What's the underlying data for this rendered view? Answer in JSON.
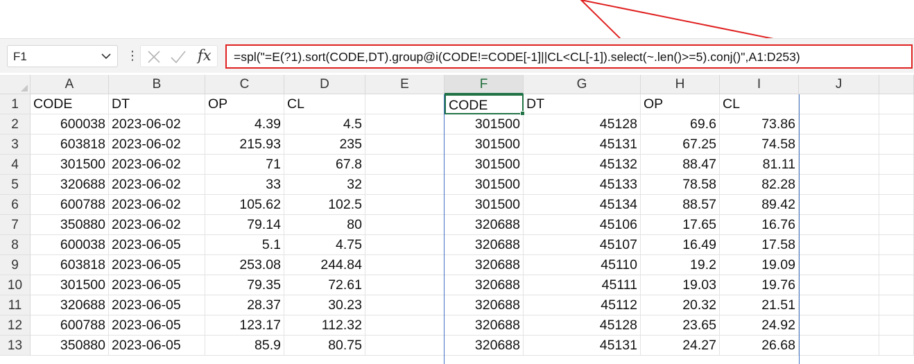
{
  "name_box": {
    "value": "F1"
  },
  "formula_bar": {
    "separator_glyph": "⋮",
    "fx_label": "fx",
    "formula": "=spl(\"=E(?1).sort(CODE,DT).group@i(CODE!=CODE[-1]||CL<CL[-1]).select(~.len()>=5).conj()\",A1:D253)"
  },
  "colors": {
    "annotation": "#e02020",
    "selection": "#217346",
    "spill_border": "#4472c4"
  },
  "icons": [
    "chevron-down-icon",
    "cancel-icon",
    "enter-check-icon",
    "function-fx-icon"
  ],
  "columns": [
    "A",
    "B",
    "C",
    "D",
    "E",
    "F",
    "G",
    "H",
    "I",
    "J"
  ],
  "rows": [
    "1",
    "2",
    "3",
    "4",
    "5",
    "6",
    "7",
    "8",
    "9",
    "10",
    "11",
    "12",
    "13"
  ],
  "active_cell": "F1",
  "cells": [
    [
      "CODE",
      "DT",
      "OP",
      "CL",
      "",
      "CODE",
      "DT",
      "OP",
      "CL",
      ""
    ],
    [
      "600038",
      "2023-06-02",
      "4.39",
      "4.5",
      "",
      "301500",
      "45128",
      "69.6",
      "73.86",
      ""
    ],
    [
      "603818",
      "2023-06-02",
      "215.93",
      "235",
      "",
      "301500",
      "45131",
      "67.25",
      "74.58",
      ""
    ],
    [
      "301500",
      "2023-06-02",
      "71",
      "67.8",
      "",
      "301500",
      "45132",
      "88.47",
      "81.11",
      ""
    ],
    [
      "320688",
      "2023-06-02",
      "33",
      "32",
      "",
      "301500",
      "45133",
      "78.58",
      "82.28",
      ""
    ],
    [
      "600788",
      "2023-06-02",
      "105.62",
      "102.5",
      "",
      "301500",
      "45134",
      "88.57",
      "89.42",
      ""
    ],
    [
      "350880",
      "2023-06-02",
      "79.14",
      "80",
      "",
      "320688",
      "45106",
      "17.65",
      "16.76",
      ""
    ],
    [
      "600038",
      "2023-06-05",
      "5.1",
      "4.75",
      "",
      "320688",
      "45107",
      "16.49",
      "17.58",
      ""
    ],
    [
      "603818",
      "2023-06-05",
      "253.08",
      "244.84",
      "",
      "320688",
      "45110",
      "19.2",
      "19.09",
      ""
    ],
    [
      "301500",
      "2023-06-05",
      "79.35",
      "72.61",
      "",
      "320688",
      "45111",
      "19.03",
      "19.76",
      ""
    ],
    [
      "320688",
      "2023-06-05",
      "28.37",
      "30.23",
      "",
      "320688",
      "45112",
      "20.32",
      "21.51",
      ""
    ],
    [
      "600788",
      "2023-06-05",
      "123.17",
      "112.32",
      "",
      "320688",
      "45128",
      "23.65",
      "24.92",
      ""
    ],
    [
      "350880",
      "2023-06-05",
      "85.9",
      "80.75",
      "",
      "320688",
      "45131",
      "24.27",
      "26.68",
      ""
    ]
  ]
}
